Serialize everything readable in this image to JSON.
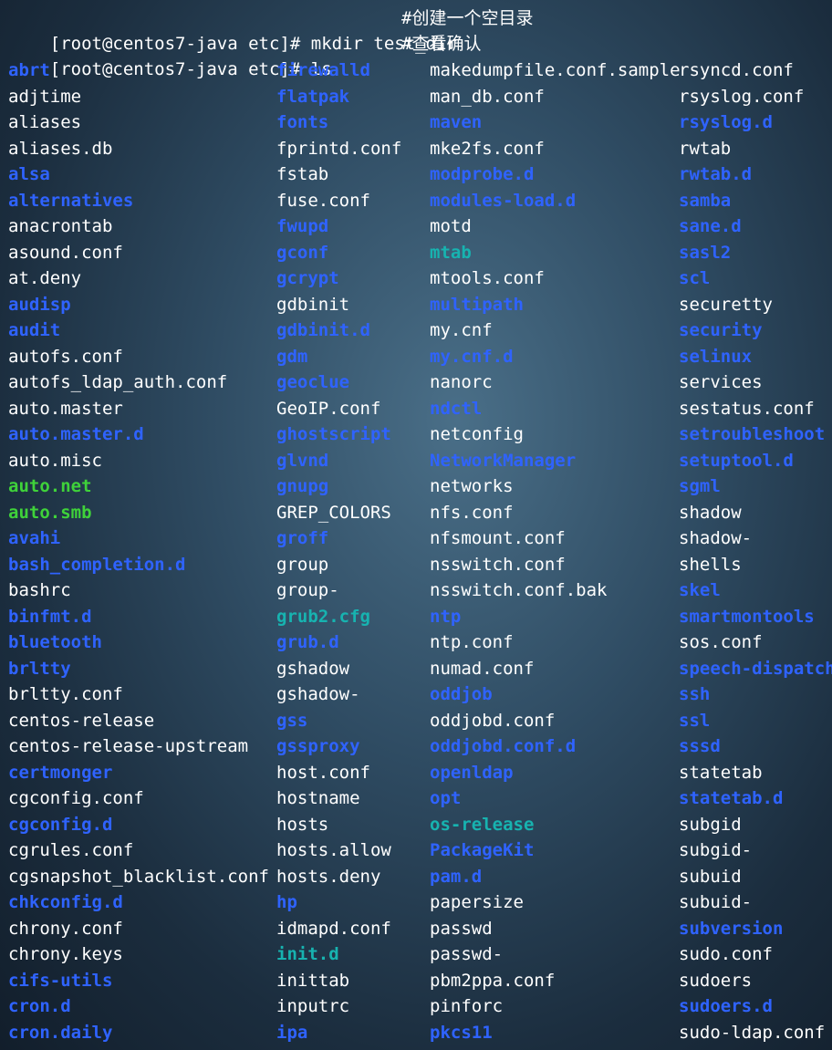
{
  "terminal": {
    "commands": [
      {
        "prompt": "[root@centos7-java etc]# ",
        "command": "mkdir test_dir",
        "comment": "#创建一个空目录"
      },
      {
        "prompt": "[root@centos7-java etc]# ",
        "command": "ls",
        "comment": "#查看确认"
      }
    ],
    "legend_colors": {
      "file": "#ffffff",
      "dir": "#2f63ff",
      "exec": "#3fd23a",
      "link": "#17b3b0"
    },
    "columns": [
      [
        {
          "name": "abrt",
          "type": "dir"
        },
        {
          "name": "adjtime",
          "type": "file"
        },
        {
          "name": "aliases",
          "type": "file"
        },
        {
          "name": "aliases.db",
          "type": "file"
        },
        {
          "name": "alsa",
          "type": "dir"
        },
        {
          "name": "alternatives",
          "type": "dir"
        },
        {
          "name": "anacrontab",
          "type": "file"
        },
        {
          "name": "asound.conf",
          "type": "file"
        },
        {
          "name": "at.deny",
          "type": "file"
        },
        {
          "name": "audisp",
          "type": "dir"
        },
        {
          "name": "audit",
          "type": "dir"
        },
        {
          "name": "autofs.conf",
          "type": "file"
        },
        {
          "name": "autofs_ldap_auth.conf",
          "type": "file"
        },
        {
          "name": "auto.master",
          "type": "file"
        },
        {
          "name": "auto.master.d",
          "type": "dir"
        },
        {
          "name": "auto.misc",
          "type": "file"
        },
        {
          "name": "auto.net",
          "type": "exec"
        },
        {
          "name": "auto.smb",
          "type": "exec"
        },
        {
          "name": "avahi",
          "type": "dir"
        },
        {
          "name": "bash_completion.d",
          "type": "dir"
        },
        {
          "name": "bashrc",
          "type": "file"
        },
        {
          "name": "binfmt.d",
          "type": "dir"
        },
        {
          "name": "bluetooth",
          "type": "dir"
        },
        {
          "name": "brltty",
          "type": "dir"
        },
        {
          "name": "brltty.conf",
          "type": "file"
        },
        {
          "name": "centos-release",
          "type": "file"
        },
        {
          "name": "centos-release-upstream",
          "type": "file"
        },
        {
          "name": "certmonger",
          "type": "dir"
        },
        {
          "name": "cgconfig.conf",
          "type": "file"
        },
        {
          "name": "cgconfig.d",
          "type": "dir"
        },
        {
          "name": "cgrules.conf",
          "type": "file"
        },
        {
          "name": "cgsnapshot_blacklist.conf",
          "type": "file"
        },
        {
          "name": "chkconfig.d",
          "type": "dir"
        },
        {
          "name": "chrony.conf",
          "type": "file"
        },
        {
          "name": "chrony.keys",
          "type": "file"
        },
        {
          "name": "cifs-utils",
          "type": "dir"
        },
        {
          "name": "cron.d",
          "type": "dir"
        },
        {
          "name": "cron.daily",
          "type": "dir"
        }
      ],
      [
        {
          "name": "firewalld",
          "type": "dir"
        },
        {
          "name": "flatpak",
          "type": "dir"
        },
        {
          "name": "fonts",
          "type": "dir"
        },
        {
          "name": "fprintd.conf",
          "type": "file"
        },
        {
          "name": "fstab",
          "type": "file"
        },
        {
          "name": "fuse.conf",
          "type": "file"
        },
        {
          "name": "fwupd",
          "type": "dir"
        },
        {
          "name": "gconf",
          "type": "dir"
        },
        {
          "name": "gcrypt",
          "type": "dir"
        },
        {
          "name": "gdbinit",
          "type": "file"
        },
        {
          "name": "gdbinit.d",
          "type": "dir"
        },
        {
          "name": "gdm",
          "type": "dir"
        },
        {
          "name": "geoclue",
          "type": "dir"
        },
        {
          "name": "GeoIP.conf",
          "type": "file"
        },
        {
          "name": "ghostscript",
          "type": "dir"
        },
        {
          "name": "glvnd",
          "type": "dir"
        },
        {
          "name": "gnupg",
          "type": "dir"
        },
        {
          "name": "GREP_COLORS",
          "type": "file"
        },
        {
          "name": "groff",
          "type": "dir"
        },
        {
          "name": "group",
          "type": "file"
        },
        {
          "name": "group-",
          "type": "file"
        },
        {
          "name": "grub2.cfg",
          "type": "link"
        },
        {
          "name": "grub.d",
          "type": "dir"
        },
        {
          "name": "gshadow",
          "type": "file"
        },
        {
          "name": "gshadow-",
          "type": "file"
        },
        {
          "name": "gss",
          "type": "dir"
        },
        {
          "name": "gssproxy",
          "type": "dir"
        },
        {
          "name": "host.conf",
          "type": "file"
        },
        {
          "name": "hostname",
          "type": "file"
        },
        {
          "name": "hosts",
          "type": "file"
        },
        {
          "name": "hosts.allow",
          "type": "file"
        },
        {
          "name": "hosts.deny",
          "type": "file"
        },
        {
          "name": "hp",
          "type": "dir"
        },
        {
          "name": "idmapd.conf",
          "type": "file"
        },
        {
          "name": "init.d",
          "type": "link"
        },
        {
          "name": "inittab",
          "type": "file"
        },
        {
          "name": "inputrc",
          "type": "file"
        },
        {
          "name": "ipa",
          "type": "dir"
        }
      ],
      [
        {
          "name": "makedumpfile.conf.sample",
          "type": "file"
        },
        {
          "name": "man_db.conf",
          "type": "file"
        },
        {
          "name": "maven",
          "type": "dir"
        },
        {
          "name": "mke2fs.conf",
          "type": "file"
        },
        {
          "name": "modprobe.d",
          "type": "dir"
        },
        {
          "name": "modules-load.d",
          "type": "dir"
        },
        {
          "name": "motd",
          "type": "file"
        },
        {
          "name": "mtab",
          "type": "link"
        },
        {
          "name": "mtools.conf",
          "type": "file"
        },
        {
          "name": "multipath",
          "type": "dir"
        },
        {
          "name": "my.cnf",
          "type": "file"
        },
        {
          "name": "my.cnf.d",
          "type": "dir"
        },
        {
          "name": "nanorc",
          "type": "file"
        },
        {
          "name": "ndctl",
          "type": "dir"
        },
        {
          "name": "netconfig",
          "type": "file"
        },
        {
          "name": "NetworkManager",
          "type": "dir"
        },
        {
          "name": "networks",
          "type": "file"
        },
        {
          "name": "nfs.conf",
          "type": "file"
        },
        {
          "name": "nfsmount.conf",
          "type": "file"
        },
        {
          "name": "nsswitch.conf",
          "type": "file"
        },
        {
          "name": "nsswitch.conf.bak",
          "type": "file"
        },
        {
          "name": "ntp",
          "type": "dir"
        },
        {
          "name": "ntp.conf",
          "type": "file"
        },
        {
          "name": "numad.conf",
          "type": "file"
        },
        {
          "name": "oddjob",
          "type": "dir"
        },
        {
          "name": "oddjobd.conf",
          "type": "file"
        },
        {
          "name": "oddjobd.conf.d",
          "type": "dir"
        },
        {
          "name": "openldap",
          "type": "dir"
        },
        {
          "name": "opt",
          "type": "dir"
        },
        {
          "name": "os-release",
          "type": "link"
        },
        {
          "name": "PackageKit",
          "type": "dir"
        },
        {
          "name": "pam.d",
          "type": "dir"
        },
        {
          "name": "papersize",
          "type": "file"
        },
        {
          "name": "passwd",
          "type": "file"
        },
        {
          "name": "passwd-",
          "type": "file"
        },
        {
          "name": "pbm2ppa.conf",
          "type": "file"
        },
        {
          "name": "pinforc",
          "type": "file"
        },
        {
          "name": "pkcs11",
          "type": "dir"
        }
      ],
      [
        {
          "name": "rsyncd.conf",
          "type": "file"
        },
        {
          "name": "rsyslog.conf",
          "type": "file"
        },
        {
          "name": "rsyslog.d",
          "type": "dir"
        },
        {
          "name": "rwtab",
          "type": "file"
        },
        {
          "name": "rwtab.d",
          "type": "dir"
        },
        {
          "name": "samba",
          "type": "dir"
        },
        {
          "name": "sane.d",
          "type": "dir"
        },
        {
          "name": "sasl2",
          "type": "dir"
        },
        {
          "name": "scl",
          "type": "dir"
        },
        {
          "name": "securetty",
          "type": "file"
        },
        {
          "name": "security",
          "type": "dir"
        },
        {
          "name": "selinux",
          "type": "dir"
        },
        {
          "name": "services",
          "type": "file"
        },
        {
          "name": "sestatus.conf",
          "type": "file"
        },
        {
          "name": "setroubleshoot",
          "type": "dir"
        },
        {
          "name": "setuptool.d",
          "type": "dir"
        },
        {
          "name": "sgml",
          "type": "dir"
        },
        {
          "name": "shadow",
          "type": "file"
        },
        {
          "name": "shadow-",
          "type": "file"
        },
        {
          "name": "shells",
          "type": "file"
        },
        {
          "name": "skel",
          "type": "dir"
        },
        {
          "name": "smartmontools",
          "type": "dir"
        },
        {
          "name": "sos.conf",
          "type": "file"
        },
        {
          "name": "speech-dispatche",
          "type": "dir"
        },
        {
          "name": "ssh",
          "type": "dir"
        },
        {
          "name": "ssl",
          "type": "dir"
        },
        {
          "name": "sssd",
          "type": "dir"
        },
        {
          "name": "statetab",
          "type": "file"
        },
        {
          "name": "statetab.d",
          "type": "dir"
        },
        {
          "name": "subgid",
          "type": "file"
        },
        {
          "name": "subgid-",
          "type": "file"
        },
        {
          "name": "subuid",
          "type": "file"
        },
        {
          "name": "subuid-",
          "type": "file"
        },
        {
          "name": "subversion",
          "type": "dir"
        },
        {
          "name": "sudo.conf",
          "type": "file"
        },
        {
          "name": "sudoers",
          "type": "file"
        },
        {
          "name": "sudoers.d",
          "type": "dir"
        },
        {
          "name": "sudo-ldap.conf",
          "type": "file"
        }
      ]
    ]
  }
}
